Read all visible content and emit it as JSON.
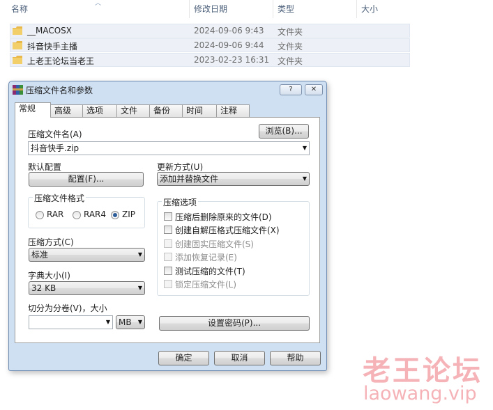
{
  "explorer": {
    "columns": {
      "name": "名称",
      "date": "修改日期",
      "type": "类型",
      "size": "大小"
    },
    "files": [
      {
        "name": "__MACOSX",
        "date": "2024-09-06 9:43",
        "type": "文件夹"
      },
      {
        "name": "抖音快手主播",
        "date": "2024-09-06 9:44",
        "type": "文件夹"
      },
      {
        "name": "上老王论坛当老王",
        "date": "2023-02-23 16:31",
        "type": "文件夹"
      }
    ]
  },
  "dialog": {
    "title": "压缩文件名和参数",
    "help_label": "?",
    "close_label": "✕",
    "tabs": [
      "常规",
      "高级",
      "选项",
      "文件",
      "备份",
      "时间",
      "注释"
    ],
    "archive_name_label": "压缩文件名(A)",
    "browse_label": "浏览(B)...",
    "archive_name_value": "抖音快手.zip",
    "default_profile_label": "默认配置",
    "profile_button": "配置(F)...",
    "update_mode_label": "更新方式(U)",
    "update_mode_value": "添加并替换文件",
    "format_group_title": "压缩文件格式",
    "formats": [
      {
        "label": "RAR",
        "checked": false
      },
      {
        "label": "RAR4",
        "checked": false
      },
      {
        "label": "ZIP",
        "checked": true
      }
    ],
    "method_label": "压缩方式(C)",
    "method_value": "标准",
    "dict_label": "字典大小(I)",
    "dict_value": "32 KB",
    "split_label": "切分为分卷(V)，大小",
    "split_value": "",
    "split_unit": "MB",
    "options_group_title": "压缩选项",
    "options": [
      {
        "label": "压缩后删除原来的文件(D)",
        "checked": false,
        "enabled": true
      },
      {
        "label": "创建自解压格式压缩文件(X)",
        "checked": false,
        "enabled": true
      },
      {
        "label": "创建固实压缩文件(S)",
        "checked": false,
        "enabled": false
      },
      {
        "label": "添加恢复记录(E)",
        "checked": false,
        "enabled": false
      },
      {
        "label": "测试压缩的文件(T)",
        "checked": false,
        "enabled": true
      },
      {
        "label": "锁定压缩文件(L)",
        "checked": false,
        "enabled": false
      }
    ],
    "password_button": "设置密码(P)...",
    "ok_button": "确定",
    "cancel_button": "取消",
    "help_button": "帮助"
  },
  "watermark": {
    "cn": "老王论坛",
    "en": "laowang.vip"
  },
  "colors": {
    "folder": "#e8b94a",
    "accent": "#2d5d9a",
    "dialog_frame": "#cfe0f3",
    "watermark": "#f5b3b8"
  }
}
